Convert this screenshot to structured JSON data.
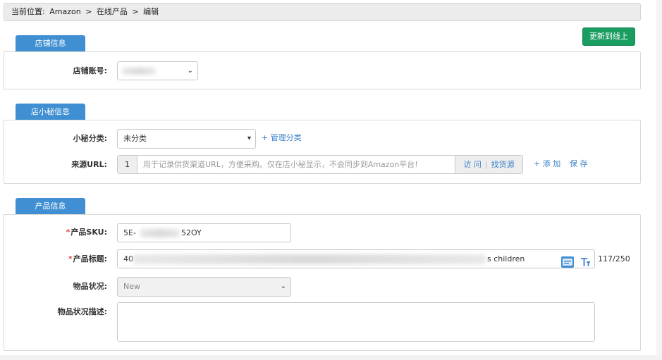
{
  "breadcrumb": {
    "prefix": "当前位置:",
    "items": [
      "Amazon",
      "在线产品",
      "编辑"
    ],
    "separator": ">"
  },
  "actions": {
    "update_label": "更新到线上",
    "update_color": "#1a9d61"
  },
  "store_section": {
    "tab": "店铺信息",
    "account_label": "店铺账号:",
    "account_value": ""
  },
  "assistant_section": {
    "tab": "店小秘信息",
    "category_label": "小秘分类:",
    "category_value": "未分类",
    "manage_link": "+ 管理分类",
    "url_label": "来源URL:",
    "url_index": "1",
    "url_placeholder": "用于记录供货渠道URL，方便采购。仅在店小秘显示，不会同步到Amazon平台!",
    "visit_label": "访 问",
    "find_source_label": "找货源",
    "add_link": "+ 添 加",
    "save_link": "保 存"
  },
  "product_section": {
    "tab": "产品信息",
    "sku_label": "产品SKU:",
    "sku_value_start": "5E-",
    "sku_value_end": "52OY",
    "title_label": "产品标题:",
    "title_value_start": "40",
    "title_value_end": "s children",
    "title_counter": "117/250",
    "condition_label": "物品状况:",
    "condition_value": "New",
    "condition_desc_label": "物品状况描述:",
    "condition_desc_value": "",
    "required_mark": "*"
  },
  "colors": {
    "tab_blue": "#3f8fd2",
    "link_blue": "#3a7fc8",
    "required_red": "#e0463c"
  }
}
